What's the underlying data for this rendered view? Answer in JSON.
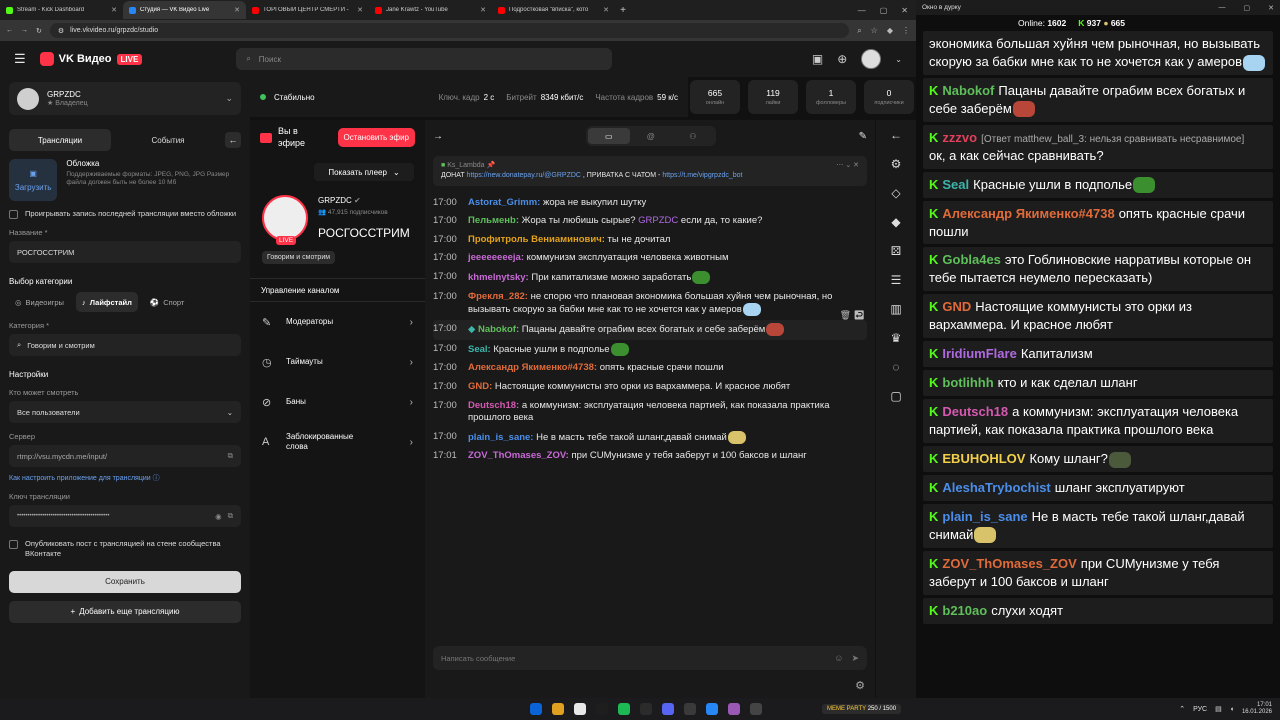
{
  "browser": {
    "tabs": [
      {
        "title": "Stream - Kick Dashboard",
        "color": "#53fc18",
        "active": false
      },
      {
        "title": "Студия — VK Видео Live",
        "color": "#2787f5",
        "active": true
      },
      {
        "title": "ТОРГОВЫЙ ЦЕНТР СМЕРТИ -",
        "color": "#ff0000",
        "active": false
      },
      {
        "title": "Jane Krawtz - YouTube",
        "color": "#ff0000",
        "active": false
      },
      {
        "title": "Подростковая \"вписка\", кото",
        "color": "#ff0000",
        "active": false
      }
    ],
    "url": "live.vkvideo.ru/grpzdc/studio"
  },
  "header": {
    "brand": "VK Видео",
    "live": "LIVE",
    "search_placeholder": "Поиск"
  },
  "left": {
    "channel_name": "GRPZDC",
    "channel_role": "Владелец",
    "tab_broadcasts": "Трансляции",
    "tab_events": "События",
    "upload": "Загрузить",
    "cover_title": "Обложка",
    "cover_hint": "Поддерживаемые форматы: JPEG, PNG, JPG Размер файла должен быть не более 10 Мб",
    "replay_label": "Проигрывать запись последней трансляции вместо обложки",
    "name_label": "Название *",
    "name_value": "РОСГОССТРИМ",
    "category_section": "Выбор категории",
    "cat_games": "Видеоигры",
    "cat_life": "Лайфстайл",
    "cat_sport": "Спорт",
    "category_label": "Категория *",
    "category_value": "Говорим и смотрим",
    "settings": "Настройки",
    "who_label": "Кто может смотреть",
    "who_value": "Все пользователи",
    "server_label": "Сервер",
    "server_value": "rtmp://vsu.mycdn.me/input/",
    "howto": "Как настроить приложение для трансляции",
    "key_label": "Ключ трансляции",
    "key_value": "••••••••••••••••••••••••••••••••••••••••••••",
    "publish_label": "Опубликовать пост с трансляцией на стене сообщества ВКонтакте",
    "save": "Сохранить",
    "add": "Добавить еще трансляцию"
  },
  "status": {
    "state": "Стабильно",
    "keyframe_label": "Ключ. кадр",
    "keyframe": "2 с",
    "bitrate_label": "Битрейт",
    "bitrate": "8349 кбит/с",
    "fps_label": "Частота кадров",
    "fps": "59 к/с"
  },
  "stats": [
    {
      "value": "665",
      "label": "онлайн"
    },
    {
      "value": "119",
      "label": "лайки"
    },
    {
      "value": "1",
      "label": "фолловеры"
    },
    {
      "value": "0",
      "label": "подписчики"
    }
  ],
  "mid": {
    "on_air": "Вы в эфире",
    "stop": "Остановить эфир",
    "show_player": "Показать плеер",
    "channel": "GRPZDC",
    "subscribers": "47,915 подписчиков",
    "live": "LIVE",
    "stream_title": "РОСГОССТРИМ",
    "tag": "Говорим и смотрим",
    "manage": "Управление каналом",
    "menu": [
      {
        "label": "Модераторы",
        "icon": "✎"
      },
      {
        "label": "Таймауты",
        "icon": "◷"
      },
      {
        "label": "Баны",
        "icon": "⊘"
      },
      {
        "label": "Заблокированные слова",
        "icon": "A"
      }
    ]
  },
  "pinned": {
    "author": "Ks_Lambda",
    "text1": "ДОНАТ ",
    "link1": "https://new.donatepay.ru/@GRPZDC",
    "text2": " , ПРИВАТКА С ЧАТОМ - ",
    "link2": "https://t.me/vipgrpzdc_bot"
  },
  "chat": [
    {
      "time": "17:00",
      "user": "Astorat_Grimm:",
      "color": "#4b8eea",
      "text": " жора не выкупил шутку"
    },
    {
      "time": "17:00",
      "user": "Пельменb:",
      "color": "#5fbf5b",
      "text": " Жора ты любишь сырые? ",
      "mention": "GRPZDC",
      "after": " если да, то какие?"
    },
    {
      "time": "17:00",
      "user": "Профитроль Вениаминович:",
      "color": "#e3a21a",
      "text": " ты не дочитал"
    },
    {
      "time": "17:00",
      "user": "jeeeeeeeeja:",
      "color": "#c86ad6",
      "text": " коммунизм эксплуатация человека животным"
    },
    {
      "time": "17:00",
      "user": "khmelnytsky:",
      "color": "#c86ad6",
      "text": " При капитализме можно заработать",
      "emoji": "#3b8f2f"
    },
    {
      "time": "17:00",
      "user": "Фрекля_282:",
      "color": "#e06b3a",
      "text": " не спорю что плановая экономика большая хуйня чем рыночная, но вызывать скорую за бабки мне как то не хочется как у амеров",
      "emoji": "#a8d4f2"
    },
    {
      "time": "17:00",
      "user": "Nabokof:",
      "color": "#5fbf5b",
      "text": " Пацаны давайте ограбим всех богатых и себе заберём",
      "emoji": "#b8473a",
      "highlight": true
    },
    {
      "time": "17:00",
      "user": "Seal:",
      "color": "#3cb6a8",
      "text": " Красные ушли в подполье",
      "emoji": "#3b8f2f"
    },
    {
      "time": "17:00",
      "user": "Александр Якименко#4738:",
      "color": "#e06b3a",
      "text": " опять красные срачи пошли"
    },
    {
      "time": "17:00",
      "user": "GND:",
      "color": "#e06b3a",
      "text": " Настоящие коммунисты это орки из вархаммера. И красное любят"
    },
    {
      "time": "17:00",
      "user": "Deutsch18:",
      "color": "#d45ab0",
      "text": " а коммунизм: эксплуатация человека партией, как показала практика прошлого века"
    },
    {
      "time": "17:00",
      "user": "plain_is_sane:",
      "color": "#4b8eea",
      "text": " Не в масть тебе такой шланг,давай снимай",
      "emoji": "#d9c36a"
    },
    {
      "time": "17:01",
      "user": "ZOV_ThOmases_ZOV:",
      "color": "#c86ad6",
      "text": " при CUMунизме у тебя заберут и 100 баксов и шланг"
    }
  ],
  "input_placeholder": "Написать сообщение",
  "right": {
    "window_title": "Окно в дурку",
    "online_label": "Online:",
    "online": "1602",
    "kick_count": "937",
    "viewers": "665",
    "messages": [
      {
        "user": "",
        "text": "экономика большая хуйня чем рыночная, но вызывать скорую за бабки мне как то не хочется как у амеров",
        "emoji": "#a8d4f2"
      },
      {
        "user": "Nabokof",
        "color": "#5fbf5b",
        "text": "Пацаны давайте ограбим всех богатых и себе заберём",
        "emoji": "#b8473a"
      },
      {
        "user": "zzzvo",
        "color": "#e0405a",
        "reply": "[Ответ matthew_ball_3: нельзя сравнивать несравнимое]",
        "text": "ок, а как сейчас сравнивать?"
      },
      {
        "user": "Seal",
        "color": "#3cb6a8",
        "text": "Красные ушли в подполье",
        "emoji": "#3b8f2f"
      },
      {
        "user": "Александр Якименко#4738",
        "color": "#e06b3a",
        "text": "опять красные срачи пошли"
      },
      {
        "user": "Gobla4es",
        "color": "#5fbf5b",
        "text": "это Гоблиновские нарративы которые он тебе пытается неумело пересказать)"
      },
      {
        "user": "GND",
        "color": "#e06b3a",
        "text": "Настоящие коммунисты это орки из вархаммера. И красное любят"
      },
      {
        "user": "IridiumFlare",
        "color": "#b06ae0",
        "text": "Капитализм"
      },
      {
        "user": "botlihhh",
        "color": "#5fbf5b",
        "text": "кто и как сделал шланг"
      },
      {
        "user": "Deutsch18",
        "color": "#d45ab0",
        "text": "а коммунизм: эксплуатация человека партией, как показала практика прошлого века"
      },
      {
        "user": "EBUHOHLOV",
        "color": "#f2d04a",
        "text": "Кому шланг?",
        "emoji": "#4a5a3a"
      },
      {
        "user": "AleshaTrybochist",
        "color": "#4b8eea",
        "text": "шланг эксплуатируют"
      },
      {
        "user": "plain_is_sane",
        "color": "#4b8eea",
        "text": "Не в масть тебе такой шланг,давай снимай",
        "emoji": "#d9c36a"
      },
      {
        "user": "ZOV_ThOmases_ZOV",
        "color": "#e06b3a",
        "text": "при CUMунизме у тебя заберут и 100 баксов и шланг"
      },
      {
        "user": "b210ao",
        "color": "#5fbf5b",
        "text": "слухи ходят"
      }
    ]
  },
  "taskbar": {
    "meme": "MEME PARTY",
    "meme_score": "250 / 1500",
    "lang": "РУС",
    "time": "17:01",
    "date": "16.01.2026"
  }
}
